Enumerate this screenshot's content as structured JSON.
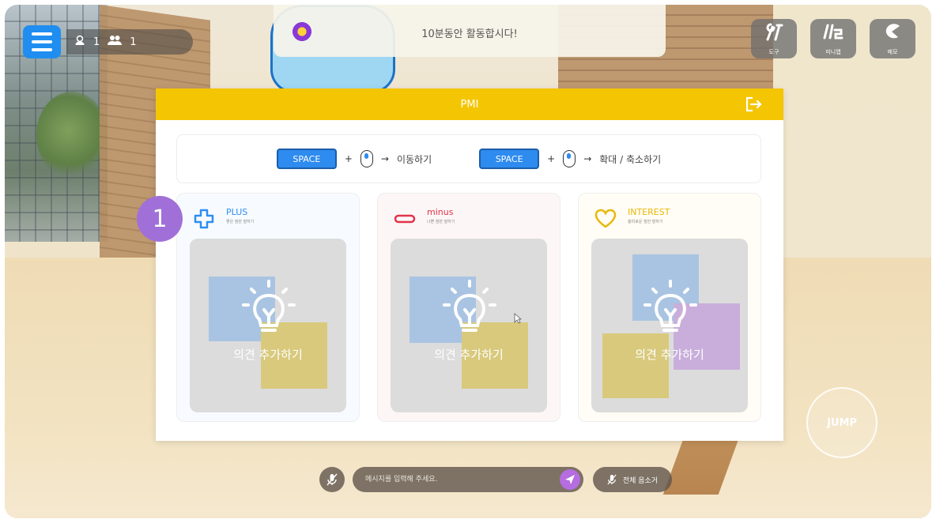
{
  "hud": {
    "user_count": "1",
    "group_count": "1"
  },
  "notice": {
    "text": "10분동안 활동합시다!"
  },
  "tools": [
    {
      "label": "도구",
      "icon": "tools-icon"
    },
    {
      "label": "미니맵",
      "icon": "minimap-icon"
    },
    {
      "label": "메모",
      "icon": "memo-icon"
    }
  ],
  "modal": {
    "title": "PMI",
    "instructions": {
      "key1": "SPACE",
      "plus1": "+",
      "arrow1": "→",
      "action1": "이동하기",
      "key2": "SPACE",
      "plus2": "+",
      "arrow2": "→",
      "action2": "확대 / 축소하기"
    },
    "cards": [
      {
        "title": "PLUS",
        "subtitle": "좋은 점만 말하기",
        "add_label": "의견 추가하기",
        "color": "#2f8ef0"
      },
      {
        "title": "minus",
        "subtitle": "나쁜 점만 말하기",
        "add_label": "의견 추가하기",
        "color": "#e0344a"
      },
      {
        "title": "INTEREST",
        "subtitle": "흥미로운 점만 말하기",
        "add_label": "의견 추가하기",
        "color": "#e8b80b"
      }
    ]
  },
  "badge": {
    "number": "1",
    "color": "#a070d8"
  },
  "jump": {
    "label": "JUMP"
  },
  "chat": {
    "placeholder": "메시지를 입력해 주세요.",
    "mute_all_label": "전체 음소거"
  },
  "colors": {
    "header": "#f4c503",
    "key": "#2e8bef",
    "menu": "#1f8ef0"
  }
}
